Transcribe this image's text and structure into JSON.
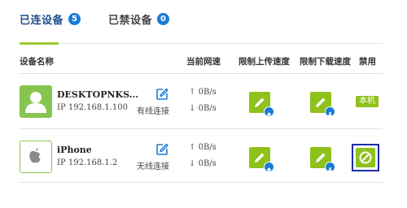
{
  "tabs": [
    {
      "label": "已连设备",
      "count": "5",
      "active": true
    },
    {
      "label": "已禁设备",
      "count": "0",
      "active": false
    }
  ],
  "table": {
    "headers": {
      "name": "设备名称",
      "speed": "当前网速",
      "upload_limit": "限制上传速度",
      "download_limit": "限制下载速度",
      "ban": "禁用"
    },
    "rows": [
      {
        "name": "DESKTOPNKS...",
        "ip": "IP 192.168.1.100",
        "connection": "有线连接",
        "up_speed": "0B/s",
        "down_speed": "0B/s",
        "ban_label": "本机",
        "avatar": "user-silhouette-icon"
      },
      {
        "name": "iPhone",
        "ip": "IP 192.168.1.2",
        "connection": "无线连接",
        "up_speed": "0B/s",
        "down_speed": "0B/s",
        "ban_label": "",
        "avatar": "apple-icon"
      }
    ]
  },
  "colors": {
    "accent_green": "#8fc11b",
    "badge_blue": "#1a7ad6",
    "tab_active_text": "#1f4e8c",
    "highlight_border": "#1b2ca8"
  }
}
